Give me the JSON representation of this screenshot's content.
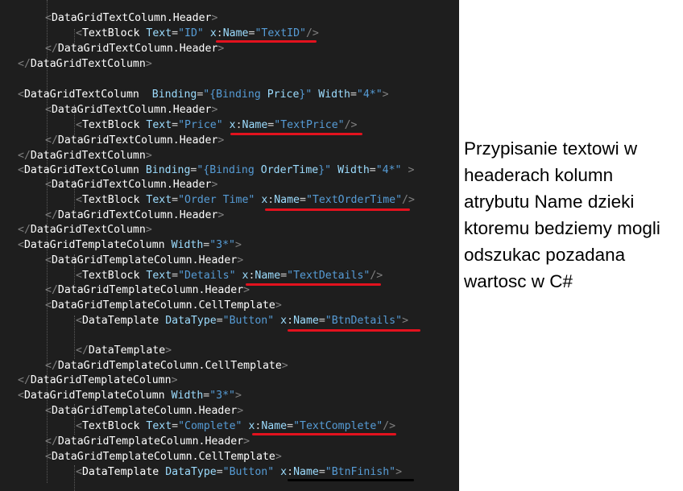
{
  "code_lines": [
    [
      {
        "t": ">",
        "c": "t-punc"
      }
    ],
    [
      {
        "t": "<",
        "c": "t-punc"
      },
      {
        "t": "DataGridTextColumn.Header",
        "c": "t-tag"
      },
      {
        "t": ">",
        "c": "t-punc"
      }
    ],
    [
      {
        "t": "<",
        "c": "t-punc"
      },
      {
        "t": "TextBlock",
        "c": "t-tag"
      },
      {
        "t": " "
      },
      {
        "t": "Text",
        "c": "t-attr"
      },
      {
        "t": "=",
        "c": "t-eq"
      },
      {
        "t": "\"ID\"",
        "c": "t-str"
      },
      {
        "t": " "
      },
      {
        "t": "x",
        "c": "t-attr"
      },
      {
        "t": ":",
        "c": "t-eq"
      },
      {
        "t": "Name",
        "c": "t-attr"
      },
      {
        "t": "=",
        "c": "t-eq"
      },
      {
        "t": "\"TextID\"",
        "c": "t-str"
      },
      {
        "t": "/>",
        "c": "t-punc"
      }
    ],
    [
      {
        "t": "</",
        "c": "t-punc"
      },
      {
        "t": "DataGridTextColumn.Header",
        "c": "t-tag"
      },
      {
        "t": ">",
        "c": "t-punc"
      }
    ],
    [
      {
        "t": "</",
        "c": "t-punc"
      },
      {
        "t": "DataGridTextColumn",
        "c": "t-tag"
      },
      {
        "t": ">",
        "c": "t-punc"
      }
    ],
    [],
    [
      {
        "t": "<",
        "c": "t-punc"
      },
      {
        "t": "DataGridTextColumn",
        "c": "t-tag"
      },
      {
        "t": "  "
      },
      {
        "t": "Binding",
        "c": "t-attr"
      },
      {
        "t": "=",
        "c": "t-eq"
      },
      {
        "t": "\"{Binding ",
        "c": "t-str"
      },
      {
        "t": "Price",
        "c": "t-attr"
      },
      {
        "t": "}\"",
        "c": "t-str"
      },
      {
        "t": " "
      },
      {
        "t": "Width",
        "c": "t-attr"
      },
      {
        "t": "=",
        "c": "t-eq"
      },
      {
        "t": "\"4*\"",
        "c": "t-str"
      },
      {
        "t": ">",
        "c": "t-punc"
      }
    ],
    [
      {
        "t": "<",
        "c": "t-punc"
      },
      {
        "t": "DataGridTextColumn.Header",
        "c": "t-tag"
      },
      {
        "t": ">",
        "c": "t-punc"
      }
    ],
    [
      {
        "t": "<",
        "c": "t-punc"
      },
      {
        "t": "TextBlock",
        "c": "t-tag"
      },
      {
        "t": " "
      },
      {
        "t": "Text",
        "c": "t-attr"
      },
      {
        "t": "=",
        "c": "t-eq"
      },
      {
        "t": "\"Price\"",
        "c": "t-str"
      },
      {
        "t": " "
      },
      {
        "t": "x",
        "c": "t-attr"
      },
      {
        "t": ":",
        "c": "t-eq"
      },
      {
        "t": "Name",
        "c": "t-attr"
      },
      {
        "t": "=",
        "c": "t-eq"
      },
      {
        "t": "\"TextPrice\"",
        "c": "t-str"
      },
      {
        "t": "/>",
        "c": "t-punc"
      }
    ],
    [
      {
        "t": "</",
        "c": "t-punc"
      },
      {
        "t": "DataGridTextColumn.Header",
        "c": "t-tag"
      },
      {
        "t": ">",
        "c": "t-punc"
      }
    ],
    [
      {
        "t": "</",
        "c": "t-punc"
      },
      {
        "t": "DataGridTextColumn",
        "c": "t-tag"
      },
      {
        "t": ">",
        "c": "t-punc"
      }
    ],
    [
      {
        "t": "<",
        "c": "t-punc"
      },
      {
        "t": "DataGridTextColumn",
        "c": "t-tag"
      },
      {
        "t": " "
      },
      {
        "t": "Binding",
        "c": "t-attr"
      },
      {
        "t": "=",
        "c": "t-eq"
      },
      {
        "t": "\"{Binding ",
        "c": "t-str"
      },
      {
        "t": "OrderTime",
        "c": "t-attr"
      },
      {
        "t": "}\"",
        "c": "t-str"
      },
      {
        "t": " "
      },
      {
        "t": "Width",
        "c": "t-attr"
      },
      {
        "t": "=",
        "c": "t-eq"
      },
      {
        "t": "\"4*\"",
        "c": "t-str"
      },
      {
        "t": " >",
        "c": "t-punc"
      }
    ],
    [
      {
        "t": "<",
        "c": "t-punc"
      },
      {
        "t": "DataGridTextColumn.Header",
        "c": "t-tag"
      },
      {
        "t": ">",
        "c": "t-punc"
      }
    ],
    [
      {
        "t": "<",
        "c": "t-punc"
      },
      {
        "t": "TextBlock",
        "c": "t-tag"
      },
      {
        "t": " "
      },
      {
        "t": "Text",
        "c": "t-attr"
      },
      {
        "t": "=",
        "c": "t-eq"
      },
      {
        "t": "\"Order Time\"",
        "c": "t-str"
      },
      {
        "t": " "
      },
      {
        "t": "x",
        "c": "t-attr"
      },
      {
        "t": ":",
        "c": "t-eq"
      },
      {
        "t": "Name",
        "c": "t-attr"
      },
      {
        "t": "=",
        "c": "t-eq"
      },
      {
        "t": "\"TextOrderTime\"",
        "c": "t-str"
      },
      {
        "t": "/>",
        "c": "t-punc"
      }
    ],
    [
      {
        "t": "</",
        "c": "t-punc"
      },
      {
        "t": "DataGridTextColumn.Header",
        "c": "t-tag"
      },
      {
        "t": ">",
        "c": "t-punc"
      }
    ],
    [
      {
        "t": "</",
        "c": "t-punc"
      },
      {
        "t": "DataGridTextColumn",
        "c": "t-tag"
      },
      {
        "t": ">",
        "c": "t-punc"
      }
    ],
    [
      {
        "t": "<",
        "c": "t-punc"
      },
      {
        "t": "DataGridTemplateColumn",
        "c": "t-tag"
      },
      {
        "t": " "
      },
      {
        "t": "Width",
        "c": "t-attr"
      },
      {
        "t": "=",
        "c": "t-eq"
      },
      {
        "t": "\"3*\"",
        "c": "t-str"
      },
      {
        "t": ">",
        "c": "t-punc"
      }
    ],
    [
      {
        "t": "<",
        "c": "t-punc"
      },
      {
        "t": "DataGridTemplateColumn.Header",
        "c": "t-tag"
      },
      {
        "t": ">",
        "c": "t-punc"
      }
    ],
    [
      {
        "t": "<",
        "c": "t-punc"
      },
      {
        "t": "TextBlock",
        "c": "t-tag"
      },
      {
        "t": " "
      },
      {
        "t": "Text",
        "c": "t-attr"
      },
      {
        "t": "=",
        "c": "t-eq"
      },
      {
        "t": "\"Details\"",
        "c": "t-str"
      },
      {
        "t": " "
      },
      {
        "t": "x",
        "c": "t-attr"
      },
      {
        "t": ":",
        "c": "t-eq"
      },
      {
        "t": "Name",
        "c": "t-attr"
      },
      {
        "t": "=",
        "c": "t-eq"
      },
      {
        "t": "\"TextDetails\"",
        "c": "t-str"
      },
      {
        "t": "/>",
        "c": "t-punc"
      }
    ],
    [
      {
        "t": "</",
        "c": "t-punc"
      },
      {
        "t": "DataGridTemplateColumn.Header",
        "c": "t-tag"
      },
      {
        "t": ">",
        "c": "t-punc"
      }
    ],
    [
      {
        "t": "<",
        "c": "t-punc"
      },
      {
        "t": "DataGridTemplateColumn.CellTemplate",
        "c": "t-tag"
      },
      {
        "t": ">",
        "c": "t-punc"
      }
    ],
    [
      {
        "t": "<",
        "c": "t-punc"
      },
      {
        "t": "DataTemplate",
        "c": "t-tag"
      },
      {
        "t": " "
      },
      {
        "t": "DataType",
        "c": "t-attr"
      },
      {
        "t": "=",
        "c": "t-eq"
      },
      {
        "t": "\"Button\"",
        "c": "t-str"
      },
      {
        "t": " "
      },
      {
        "t": "x",
        "c": "t-attr"
      },
      {
        "t": ":",
        "c": "t-eq"
      },
      {
        "t": "Name",
        "c": "t-attr"
      },
      {
        "t": "=",
        "c": "t-eq"
      },
      {
        "t": "\"BtnDetails\"",
        "c": "t-str"
      },
      {
        "t": ">",
        "c": "t-punc"
      }
    ],
    [],
    [
      {
        "t": "</",
        "c": "t-punc"
      },
      {
        "t": "DataTemplate",
        "c": "t-tag"
      },
      {
        "t": ">",
        "c": "t-punc"
      }
    ],
    [
      {
        "t": "</",
        "c": "t-punc"
      },
      {
        "t": "DataGridTemplateColumn.CellTemplate",
        "c": "t-tag"
      },
      {
        "t": ">",
        "c": "t-punc"
      }
    ],
    [
      {
        "t": "</",
        "c": "t-punc"
      },
      {
        "t": "DataGridTemplateColumn",
        "c": "t-tag"
      },
      {
        "t": ">",
        "c": "t-punc"
      }
    ],
    [
      {
        "t": "<",
        "c": "t-punc"
      },
      {
        "t": "DataGridTemplateColumn",
        "c": "t-tag"
      },
      {
        "t": " "
      },
      {
        "t": "Width",
        "c": "t-attr"
      },
      {
        "t": "=",
        "c": "t-eq"
      },
      {
        "t": "\"3*\"",
        "c": "t-str"
      },
      {
        "t": ">",
        "c": "t-punc"
      }
    ],
    [
      {
        "t": "<",
        "c": "t-punc"
      },
      {
        "t": "DataGridTemplateColumn.Header",
        "c": "t-tag"
      },
      {
        "t": ">",
        "c": "t-punc"
      }
    ],
    [
      {
        "t": "<",
        "c": "t-punc"
      },
      {
        "t": "TextBlock",
        "c": "t-tag"
      },
      {
        "t": " "
      },
      {
        "t": "Text",
        "c": "t-attr"
      },
      {
        "t": "=",
        "c": "t-eq"
      },
      {
        "t": "\"Complete\"",
        "c": "t-str"
      },
      {
        "t": " "
      },
      {
        "t": "x",
        "c": "t-attr"
      },
      {
        "t": ":",
        "c": "t-eq"
      },
      {
        "t": "Name",
        "c": "t-attr"
      },
      {
        "t": "=",
        "c": "t-eq"
      },
      {
        "t": "\"TextComplete\"",
        "c": "t-str"
      },
      {
        "t": "/>",
        "c": "t-punc"
      }
    ],
    [
      {
        "t": "</",
        "c": "t-punc"
      },
      {
        "t": "DataGridTemplateColumn.Header",
        "c": "t-tag"
      },
      {
        "t": ">",
        "c": "t-punc"
      }
    ],
    [
      {
        "t": "<",
        "c": "t-punc"
      },
      {
        "t": "DataGridTemplateColumn.CellTemplate",
        "c": "t-tag"
      },
      {
        "t": ">",
        "c": "t-punc"
      }
    ],
    [
      {
        "t": "<",
        "c": "t-punc"
      },
      {
        "t": "DataTemplate",
        "c": "t-tag"
      },
      {
        "t": " "
      },
      {
        "t": "DataType",
        "c": "t-attr"
      },
      {
        "t": "=",
        "c": "t-eq"
      },
      {
        "t": "\"Button\"",
        "c": "t-str"
      },
      {
        "t": " "
      },
      {
        "t": "x",
        "c": "t-attr"
      },
      {
        "t": ":",
        "c": "t-eq"
      },
      {
        "t": "Name",
        "c": "t-attr"
      },
      {
        "t": "=",
        "c": "t-eq"
      },
      {
        "t": "\"BtnFinish\"",
        "c": "t-str"
      },
      {
        "t": ">",
        "c": "t-punc"
      }
    ]
  ],
  "annotation": {
    "lines": [
      "Przypisanie textowi w",
      "headerach kolumn",
      "atrybutu Name dzieki",
      "ktoremu bedziemy mogli",
      "odszukac pozadana",
      "wartosc w C#"
    ]
  },
  "colors": {
    "editor_background": "#1e1e1e",
    "tag": "#ffffff",
    "punctuation": "#808080",
    "attribute": "#9cdcfe",
    "string": "#569cd6",
    "highlight_underline": "#e3121e"
  }
}
